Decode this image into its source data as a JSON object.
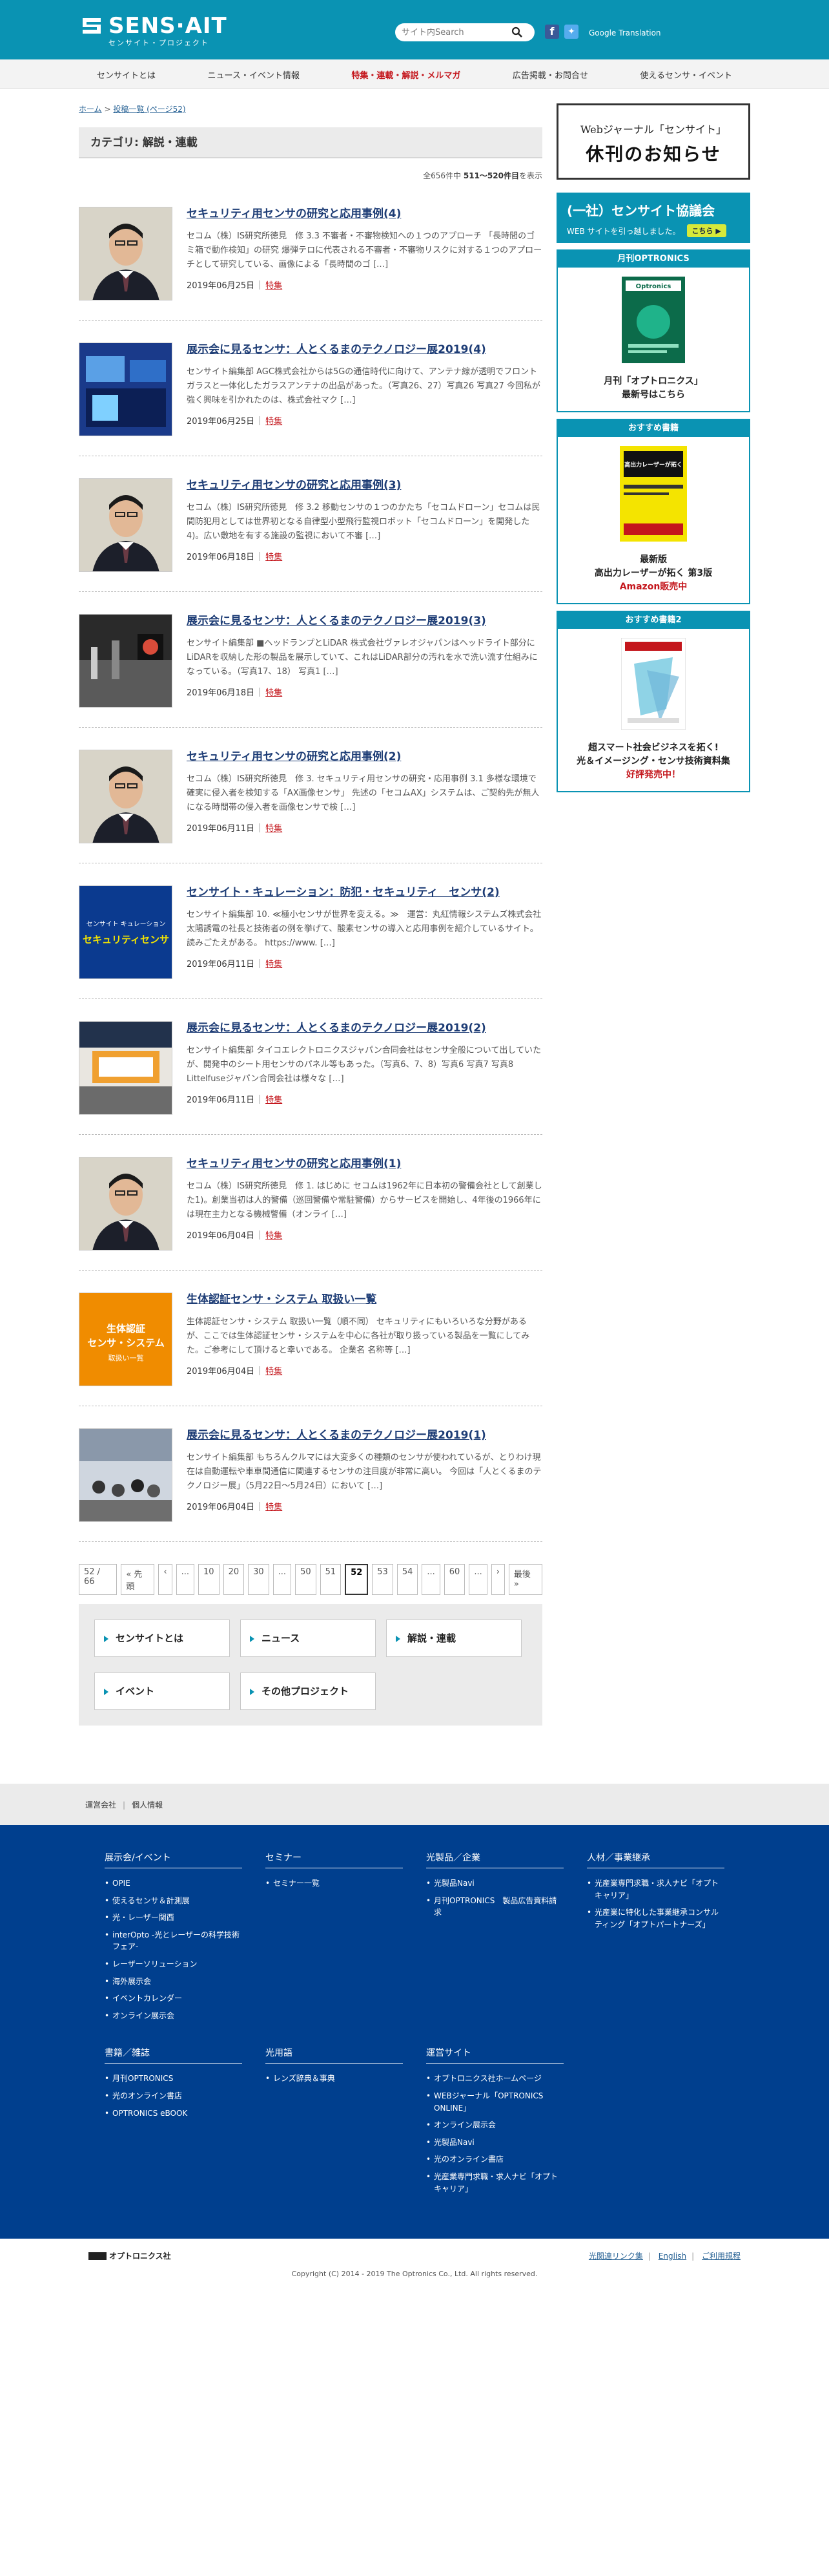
{
  "header": {
    "logo_text": "SENS·AIT",
    "logo_sub": "センサイト・プロジェクト",
    "search_placeholder": "サイト内Search",
    "translation": "Google Translation"
  },
  "gnav": [
    {
      "label": "センサイトとは",
      "highlight": false
    },
    {
      "label": "ニュース・イベント情報",
      "highlight": false
    },
    {
      "label": "特集・連載・解説・メルマガ",
      "highlight": true
    },
    {
      "label": "広告掲載・お問合せ",
      "highlight": false
    },
    {
      "label": "使えるセンサ・イベント",
      "highlight": false
    }
  ],
  "breadcrumb": {
    "home": "ホーム",
    "sep": " > ",
    "current": "投稿一覧 (ページ52)"
  },
  "category_title": "カテゴリ: 解説・連載",
  "count": {
    "prefix": "全656件中 ",
    "range": "511〜520件目",
    "suffix": "を表示"
  },
  "posts": [
    {
      "title": "セキュリティ用センサの研究と応用事例(4)",
      "excerpt": "セコム（株）IS研究所徳見　修 3.3 不審者・不審物検知への１つのアプローチ 「長時間のゴミ箱で動作検知」の研究 爆弾テロに代表される不審者・不審物リスクに対する１つのアプローチとして研究している、画像による「長時間のゴ […]",
      "date": "2019年06月25日",
      "tag": "特集",
      "thumb": "person"
    },
    {
      "title": "展示会に見るセンサ：人とくるまのテクノロジー展2019(4)",
      "excerpt": "センサイト編集部 AGC株式会社からは5Gの通信時代に向けて、アンテナ線が透明でフロントガラスと一体化したガラスアンテナの出品があった。（写真26、27）写真26 写真27 今回私が強く興味を引かれたのは、株式会社マク […]",
      "date": "2019年06月25日",
      "tag": "特集",
      "thumb": "expo-blue"
    },
    {
      "title": "セキュリティ用センサの研究と応用事例(3)",
      "excerpt": "セコム（株）IS研究所徳見　修 3.2 移動センサの１つのかたち「セコムドローン」セコムは民間防犯用としては世界初となる自律型小型飛行監視ロボット「セコムドローン」を開発した4)。広い敷地を有する施設の監視において不審 […]",
      "date": "2019年06月18日",
      "tag": "特集",
      "thumb": "person"
    },
    {
      "title": "展示会に見るセンサ：人とくるまのテクノロジー展2019(3)",
      "excerpt": "センサイト編集部 ■ヘッドランプとLiDAR 株式会社ヴァレオジャパンはヘッドライト部分にLiDARを収納した形の製品を展示していて、これはLiDAR部分の汚れを水で洗い流す仕組みになっている。（写真17、18） 写真1 […]",
      "date": "2019年06月18日",
      "tag": "特集",
      "thumb": "expo-dark"
    },
    {
      "title": "セキュリティ用センサの研究と応用事例(2)",
      "excerpt": "セコム（株）IS研究所徳見　修 3. セキュリティ用センサの研究・応用事例 3.1 多様な環境で確実に侵入者を検知する「AX画像センサ」 先述の「セコムAX」システムは、ご契約先が無人になる時間帯の侵入者を画像センサで検 […]",
      "date": "2019年06月11日",
      "tag": "特集",
      "thumb": "person"
    },
    {
      "title": "センサイト・キュレーション：防犯・セキュリティ　センサ(2)",
      "excerpt": "センサイト編集部 10. ≪極小センサが世界を変える。≫　運営：丸紅情報システムズ株式会社 太陽誘電の社長と技術者の例を挙げて、酸素センサの導入と応用事例を紹介しているサイト。読みごたえがある。 https://www. […]",
      "date": "2019年06月11日",
      "tag": "特集",
      "thumb": "curation"
    },
    {
      "title": "展示会に見るセンサ：人とくるまのテクノロジー展2019(2)",
      "excerpt": "センサイト編集部 タイコエレクトロニクスジャパン合同会社はセンサ全般について出していたが、開発中のシート用センサのパネル等もあった。（写真6、7、8）写真6 写真7 写真8 Littelfuseジャパン合同会社は様々な […]",
      "date": "2019年06月11日",
      "tag": "特集",
      "thumb": "expo-booth"
    },
    {
      "title": "セキュリティ用センサの研究と応用事例(1)",
      "excerpt": "セコム（株）IS研究所徳見　修 1. はじめに セコムは1962年に日本初の警備会社として創業した1)。創業当初は人的警備（巡回警備や常駐警備）からサービスを開始し、4年後の1966年には現在主力となる機械警備（オンライ […]",
      "date": "2019年06月04日",
      "tag": "特集",
      "thumb": "person"
    },
    {
      "title": "生体認証センサ・システム 取扱い一覧",
      "excerpt": "生体認証センサ・システム 取扱い一覧（順不同） セキュリティにもいろいろな分野があるが、ここでは生体認証センサ・システムを中心に各社が取り扱っている製品を一覧にしてみた。ご参考にして頂けると幸いである。 企業名 名称等 […]",
      "date": "2019年06月04日",
      "tag": "特集",
      "thumb": "bio"
    },
    {
      "title": "展示会に見るセンサ：人とくるまのテクノロジー展2019(1)",
      "excerpt": "センサイト編集部 もちろんクルマには大変多くの種類のセンサが使われているが、とりわけ現在は自動運転や車車間通信に関連するセンサの注目度が非常に高い。 今回は「人とくるまのテクノロジー展」（5月22日〜5月24日）において […]",
      "date": "2019年06月04日",
      "tag": "特集",
      "thumb": "expo-crowd"
    }
  ],
  "thumb_text": {
    "curation_l1": "センサイト キュレーション",
    "curation_l2": "セキュリティセンサ",
    "bio_l1": "生体認証",
    "bio_l2": "センサ・システム",
    "bio_l3": "取扱い一覧"
  },
  "pager": [
    "52 / 66",
    "« 先頭",
    "‹",
    "...",
    "10",
    "20",
    "30",
    "...",
    "50",
    "51",
    "52",
    "53",
    "54",
    "...",
    "60",
    "...",
    "›",
    "最後 »"
  ],
  "pager_current": "52",
  "subnav": [
    "センサイトとは",
    "ニュース",
    "解説・連載",
    "イベント",
    "その他プロジェクト"
  ],
  "sidebar": {
    "notice_l1": "Webジャーナル「センサイト」",
    "notice_l2": "休刊のお知らせ",
    "assoc_title": "(一社）センサイト協議会",
    "assoc_sub": "WEB サイトを引っ越しました。",
    "assoc_btn": "こちら ▶",
    "box1_head": "月刊OPTRONICS",
    "box1_cap1": "月刊「オプトロニクス」",
    "box1_cap2": "最新号はこちら",
    "box2_head": "おすすめ書籍",
    "box2_cap1": "最新版",
    "box2_cap2": "高出力レーザーが拓く 第3版",
    "box2_cap3": "Amazon販売中",
    "box2_book_title": "高出力レーザーが拓く",
    "box3_head": "おすすめ書籍2",
    "box3_cap1": "超スマート社会ビジネスを拓く!",
    "box3_cap2": "光＆イメージング・センサ技術資料集",
    "box3_cap3": "好評発売中！"
  },
  "footer": {
    "links": [
      "運営会社",
      "個人情報"
    ],
    "columns": [
      {
        "title": "展示会/イベント",
        "items": [
          "OPIE",
          "使えるセンサ＆計測展",
          "光・レーザー関西",
          "interOpto -光とレーザーの科学技術フェア-",
          "レーザーソリューション",
          "海外展示会",
          "イベントカレンダー",
          "オンライン展示会"
        ]
      },
      {
        "title": "セミナー",
        "items": [
          "セミナー一覧"
        ]
      },
      {
        "title": "光製品／企業",
        "items": [
          "光製品Navi",
          "月刊OPTRONICS　製品広告資料請求"
        ]
      },
      {
        "title": "人材／事業継承",
        "items": [
          "光産業専門求職・求人ナビ「オプトキャリア」",
          "光産業に特化した事業継承コンサルティング「オプトパートナーズ」"
        ]
      },
      {
        "title": "書籍／雑誌",
        "items": [
          "月刊OPTRONICS",
          "光のオンライン書店",
          "OPTRONICS eBOOK"
        ]
      },
      {
        "title": "光用語",
        "items": [
          "レンズ辞典＆事典"
        ]
      },
      {
        "title": "運営サイト",
        "items": [
          "オプトロニクス社ホームページ",
          "WEBジャーナル「OPTRONICS ONLINE」",
          "オンライン展示会",
          "光製品Navi",
          "光のオンライン書店",
          "光産業専門求職・求人ナビ「オプトキャリア」"
        ]
      }
    ],
    "company_logo": "オプトロニクス社",
    "bottom_links": [
      "光関連リンク集",
      "English",
      "ご利用規程"
    ],
    "copyright": "Copyright (C) 2014 - 2019 The Optronics Co., Ltd. All rights reserved."
  }
}
